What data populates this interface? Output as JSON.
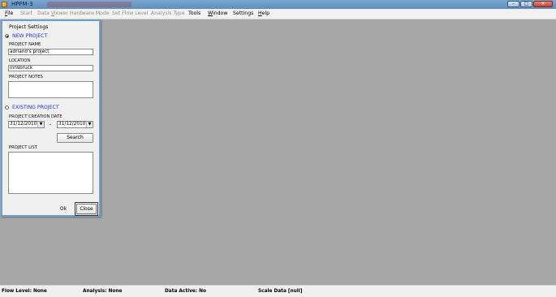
{
  "window": {
    "title": "HPFM-3"
  },
  "menu": [
    {
      "label": "File",
      "enabled": true
    },
    {
      "label": "Start",
      "enabled": false
    },
    {
      "label": "Data Viewer",
      "enabled": false
    },
    {
      "label": "Hardware Mode",
      "enabled": false
    },
    {
      "label": "Set Flow Level",
      "enabled": false
    },
    {
      "label": "Analysis Type",
      "enabled": false
    },
    {
      "label": "Tools",
      "enabled": true
    },
    {
      "label": "Window",
      "enabled": true
    },
    {
      "label": "Settings",
      "enabled": true
    },
    {
      "label": "Help",
      "enabled": true
    }
  ],
  "dialog": {
    "title": "Project Settings",
    "new_project": {
      "label": "NEW PROJECT",
      "selected": true,
      "name_label": "PROJECT NAME",
      "name_value": "adriano's project",
      "location_label": "LOCATION",
      "location_value": "innsbruck",
      "notes_label": "PROJECT NOTES",
      "notes_value": ""
    },
    "existing_project": {
      "label": "EXISTING PROJECT",
      "selected": false,
      "date_label": "PROJECT CREATION DATE",
      "date_from": "31/12/2010",
      "date_separator": "-",
      "date_to": "31/12/2010",
      "search_label": "Search",
      "list_label": "PROJECT LIST",
      "list_items": []
    },
    "ok_label": "Ok",
    "close_label": "Close"
  },
  "status": {
    "flow_level": "Flow Level: None",
    "analysis": "Analysis: None",
    "data_active": "Data Active: No",
    "scale_data": "Scale Data  [null]"
  }
}
